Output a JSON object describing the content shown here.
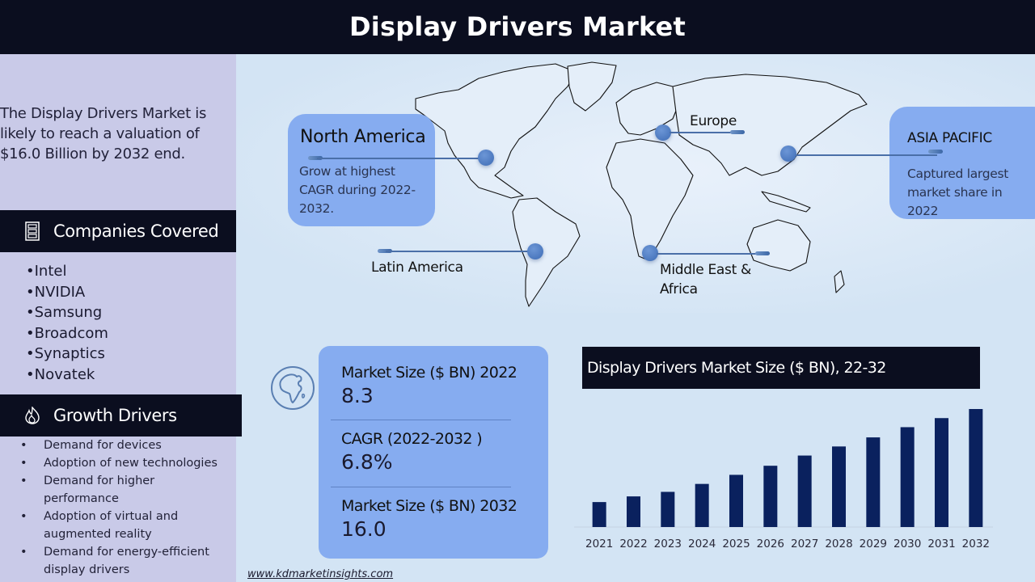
{
  "header": {
    "title": "Display Drivers Market"
  },
  "sidebar": {
    "intro": "The Display Drivers Market is likely to reach a valuation of $16.0 Billion by 2032 end.",
    "companies_section": {
      "title": "Companies Covered",
      "icon": "building-icon"
    },
    "companies": [
      "Intel",
      "NVIDIA",
      "Samsung",
      "Broadcom",
      "Synaptics",
      "Novatek"
    ],
    "drivers_section": {
      "title": "Growth Drivers",
      "icon": "flame-icon"
    },
    "drivers": [
      "Demand for devices",
      "Adoption of new technologies",
      "Demand for higher performance",
      "Adoption of virtual and augmented reality",
      "Demand for energy-efficient display drivers"
    ]
  },
  "regions": {
    "north_america": {
      "title": "North America",
      "desc_lines": [
        "Grow at highest",
        "CAGR during 2022-",
        "2032."
      ]
    },
    "latin_america": {
      "title": "Latin America"
    },
    "europe": {
      "title": "Europe"
    },
    "asia_pacific": {
      "title": "ASIA PACIFIC",
      "desc_lines": [
        "Captured largest",
        "market share in 2022"
      ]
    },
    "mea": {
      "title_lines": [
        "Middle East &",
        "Africa"
      ]
    }
  },
  "stats": [
    {
      "label": "Market Size ($ BN) 2022",
      "value": "8.3"
    },
    {
      "label": "CAGR (2022-2032 )",
      "value": "6.8%"
    },
    {
      "label": "Market Size ($ BN) 2032",
      "value": "16.0"
    }
  ],
  "colors": {
    "dark": "#0b0e1f",
    "bar": "#0a215e",
    "callout": "#86acf0",
    "sidebar": "#c9cae8",
    "background": "#d3e4f4"
  },
  "chart_data": {
    "type": "bar",
    "title": "Display Drivers Market Size ($ BN), 22-32",
    "xlabel": "",
    "ylabel": "",
    "categories": [
      "2021",
      "2022",
      "2023",
      "2024",
      "2025",
      "2026",
      "2027",
      "2028",
      "2029",
      "2030",
      "2031",
      "2032"
    ],
    "values": [
      7.8,
      8.3,
      8.7,
      9.4,
      10.2,
      11.0,
      11.9,
      12.7,
      13.5,
      14.4,
      15.2,
      16.0
    ],
    "ylim": [
      5.6,
      16.0
    ],
    "grid": false,
    "legend": "none"
  },
  "footer": {
    "url": "www.kdmarketinsights.com"
  }
}
